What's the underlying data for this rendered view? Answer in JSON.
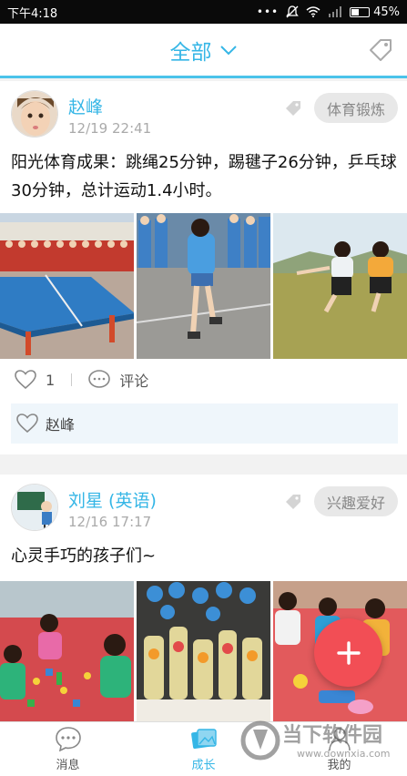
{
  "status_bar": {
    "time": "下午4:18",
    "battery": "45%",
    "battery_level": 0.45
  },
  "header": {
    "title": "全部"
  },
  "posts": [
    {
      "author": "赵峰",
      "time": "12/19 22:41",
      "category": "体育锻炼",
      "text": "阳光体育成果：跳绳25分钟，踢毽子26分钟，乒乓球30分钟，总计运动1.4小时。",
      "like_count": "1",
      "comment_label": "评论",
      "liked_by": "赵峰"
    },
    {
      "author": "刘星 (英语)",
      "time": "12/16 17:17",
      "category": "兴趣爱好",
      "text": "心灵手巧的孩子们~"
    }
  ],
  "tabs": [
    {
      "label": "消息"
    },
    {
      "label": "成长"
    },
    {
      "label": "我的"
    }
  ],
  "watermark": {
    "name": "当下软件园",
    "url": "www.downxia.com"
  },
  "colors": {
    "accent": "#35b6e6",
    "fab": "#f24e55",
    "likes_bg": "#eff6fb"
  }
}
